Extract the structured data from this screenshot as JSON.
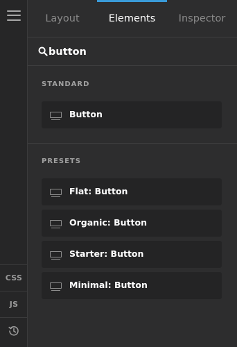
{
  "tabs": {
    "layout": "Layout",
    "elements": "Elements",
    "inspector": "Inspector"
  },
  "search": {
    "value": "button"
  },
  "rail": {
    "css": "CSS",
    "js": "JS"
  },
  "sections": {
    "standard": {
      "title": "STANDARD",
      "items": [
        "Button"
      ]
    },
    "presets": {
      "title": "PRESETS",
      "items": [
        "Flat: Button",
        "Organic: Button",
        "Starter: Button",
        "Minimal: Button"
      ]
    }
  },
  "colors": {
    "accent": "#3a9bd9",
    "background": "#2d2d2e",
    "rail": "#262627",
    "item": "#242425"
  },
  "icons": {
    "menu": "hamburger-icon",
    "search": "search-icon",
    "history": "history-icon",
    "element": "button-element-icon"
  }
}
